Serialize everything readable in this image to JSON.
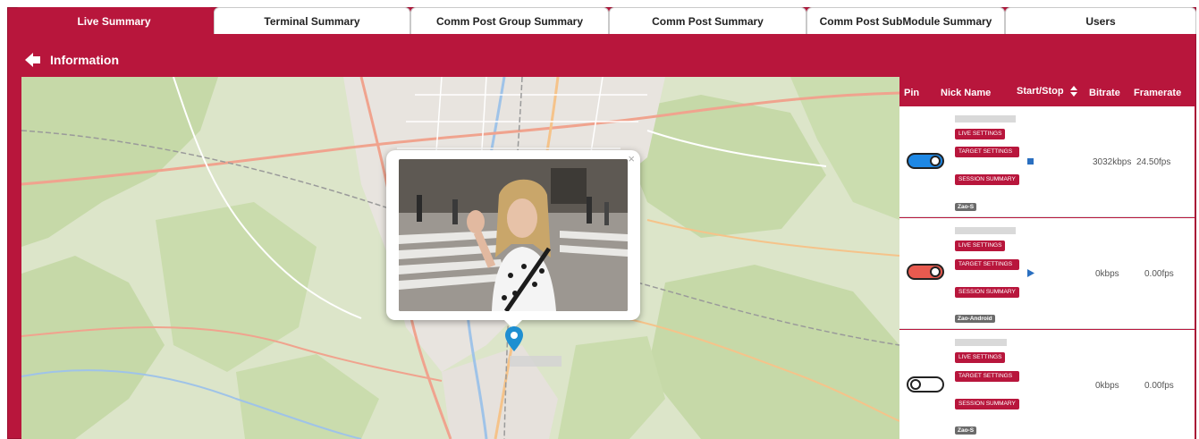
{
  "tabs": [
    {
      "label": "Live Summary",
      "active": true
    },
    {
      "label": "Terminal Summary",
      "active": false
    },
    {
      "label": "Comm Post Group Summary",
      "active": false
    },
    {
      "label": "Comm Post Summary",
      "active": false
    },
    {
      "label": "Comm Post SubModule Summary",
      "active": false
    },
    {
      "label": "Users",
      "active": false
    }
  ],
  "header": {
    "title": "Information",
    "back_icon": "arrow-left-icon"
  },
  "colors": {
    "brand": "#b8163c",
    "toggle_on": "#1e88e5",
    "toggle_warn": "#e85a4f",
    "control": "#2a6fc0"
  },
  "table": {
    "columns": {
      "pin": "Pin",
      "nick_name": "Nick Name",
      "start_stop": "Start/Stop",
      "bitrate": "Bitrate",
      "framerate": "Framerate"
    },
    "button_labels": {
      "live": "LIVE SETTINGS",
      "target": "TARGET SETTINGS",
      "session": "SESSION SUMMARY"
    },
    "rows": [
      {
        "toggle_state": "on-blue",
        "control_icon": "stop-icon",
        "bitrate": "3032kbps",
        "framerate": "24.50fps",
        "tag": "Zao-S"
      },
      {
        "toggle_state": "on-red",
        "control_icon": "play-icon",
        "bitrate": "0kbps",
        "framerate": "0.00fps",
        "tag": "Zao-Android"
      },
      {
        "toggle_state": "off",
        "control_icon": "",
        "bitrate": "0kbps",
        "framerate": "0.00fps",
        "tag": "Zao-S"
      }
    ]
  }
}
